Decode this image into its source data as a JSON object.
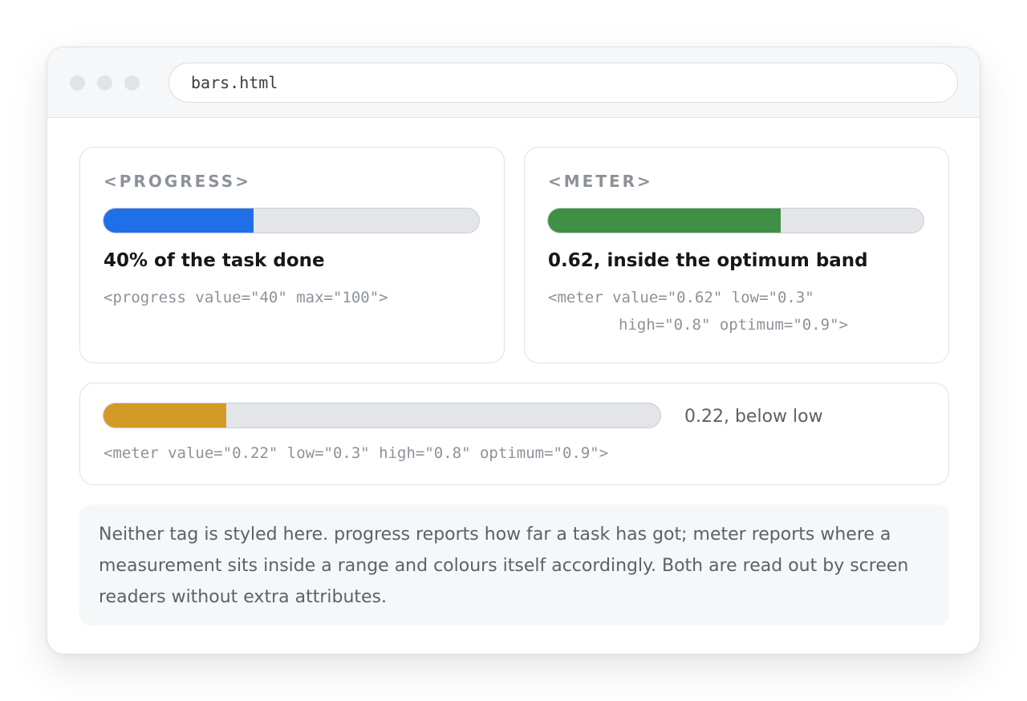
{
  "window": {
    "url": "bars.html"
  },
  "progress_card": {
    "eyebrow": "<PROGRESS>",
    "value": 40,
    "max": 100,
    "caption": "40% of the task done",
    "code": "<progress value=\"40\" max=\"100\">",
    "color": "#1f6fe8"
  },
  "meter_card": {
    "eyebrow": "<METER>",
    "value": 0.62,
    "min": 0,
    "max": 1,
    "caption": "0.62, inside the optimum band",
    "code_line1": "<meter value=\"0.62\" low=\"0.3\"",
    "code_line2": "high=\"0.8\" optimum=\"0.9\">",
    "color": "#3f8f44"
  },
  "low_card": {
    "value": 0.22,
    "min": 0,
    "max": 1,
    "label": "0.22, below low",
    "code": "<meter value=\"0.22\" low=\"0.3\" high=\"0.8\" optimum=\"0.9\">",
    "color": "#d39a25"
  },
  "note": {
    "text": "Neither tag is styled here. progress reports how far a task has got; meter reports where a measurement sits inside a range and colours itself accordingly. Both are read out by screen readers without extra attributes."
  },
  "colors": {
    "track": "#e3e5e8",
    "text_muted": "#8d9299",
    "text_strong": "#15171a"
  }
}
